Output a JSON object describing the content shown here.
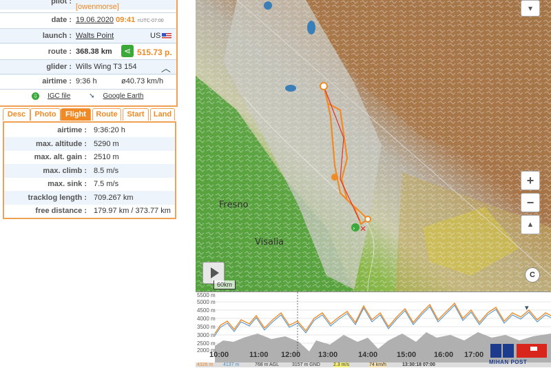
{
  "info": {
    "pilot_label": "pilot :",
    "pilot_handle": "[owenmorse]",
    "date_label": "date :",
    "date": "19.06.2020",
    "time": "09:41",
    "tz": "=UTC-07:00",
    "launch_label": "launch :",
    "launch": "Walts Point",
    "country": "US",
    "route_label": "route :",
    "route_km": "368.38 km",
    "route_points": "515.73 p.",
    "glider_label": "glider :",
    "glider": "Wills Wing T3 154",
    "airtime_label": "airtime :",
    "airtime": "9:36 h",
    "avg_speed": "ø40.73 km/h",
    "igc_link": "IGC file",
    "ge_link": "Google Earth"
  },
  "tabs": [
    {
      "label": "Desc"
    },
    {
      "label": "Photo"
    },
    {
      "label": "Flight"
    },
    {
      "label": "Route"
    },
    {
      "label": "Start"
    },
    {
      "label": "Land"
    }
  ],
  "stats": [
    {
      "label": "airtime :",
      "value": "9:36:20 h"
    },
    {
      "label": "max. altitude :",
      "value": "5290 m"
    },
    {
      "label": "max. alt. gain :",
      "value": "2510 m"
    },
    {
      "label": "max. climb :",
      "value": "8.5 m/s"
    },
    {
      "label": "max. sink :",
      "value": "7.5 m/s"
    },
    {
      "label": "tracklog length :",
      "value": "709.267 km"
    },
    {
      "label": "free distance :",
      "value": "179.97 km / 373.77 km"
    }
  ],
  "map": {
    "city1": "Fresno",
    "city2": "Visalia",
    "zoom_in": "+",
    "zoom_out": "−",
    "scale": "60km",
    "copyright": "C"
  },
  "chart": {
    "y_labels": [
      "5500 m",
      "5000 m",
      "4500 m",
      "4000 m",
      "3500 m",
      "3000 m",
      "2500 m",
      "2000 m"
    ],
    "x_labels": [
      "10:00",
      "11:00",
      "12:00",
      "13:00",
      "14:00",
      "15:00",
      "16:00",
      "17:00"
    ]
  },
  "status": {
    "alt": "4326 m",
    "alt2": "4137 m",
    "agl": "768 m AGL",
    "gnd": "3157 m GND",
    "climb": "2.3 m/s",
    "speed": "74 km/h",
    "time": "13:30:18 07:00"
  },
  "logo": {
    "text": "MIHAN POST"
  }
}
